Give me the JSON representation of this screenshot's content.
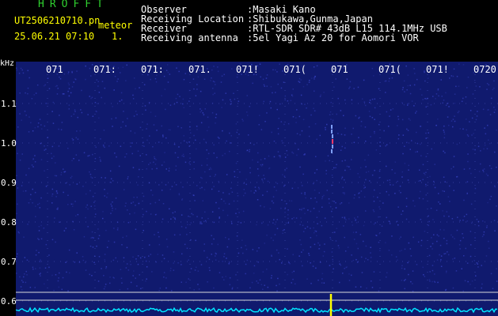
{
  "header": {
    "app_title": "HROFFT",
    "file_name": "UT2506210710.pn",
    "meteor_label": "meteor",
    "datetime": "25.06.21 07:10",
    "counter": "1.",
    "fields": [
      {
        "key": "Observer",
        "value": ":Masaki Kano"
      },
      {
        "key": "Receiving Location",
        "value": ":Shibukawa,Gunma,Japan"
      },
      {
        "key": "Receiver",
        "value": ":RTL-SDR SDR# 43dB L15 114.1MHz USB"
      },
      {
        "key": "Receiving antenna",
        "value": ":5el Yagi Az 20 for Aomori VOR"
      }
    ]
  },
  "spectrogram": {
    "y_unit": "kHz",
    "y_ticks": [
      "1.1",
      "1.0",
      "0.9",
      "0.8",
      "0.7",
      "0.6"
    ],
    "time_ticks": [
      "071",
      "071:",
      "071:",
      "071.",
      "071!",
      "071(",
      "071",
      "071(",
      "071!",
      "0720"
    ],
    "colors": {
      "background": "#101a6e",
      "noise": "#3a46c8",
      "signal": "#ff3b6b",
      "baseline": "#00e5ff",
      "marker": "#ffff00",
      "ref_line": "#d9d9d9"
    }
  }
}
